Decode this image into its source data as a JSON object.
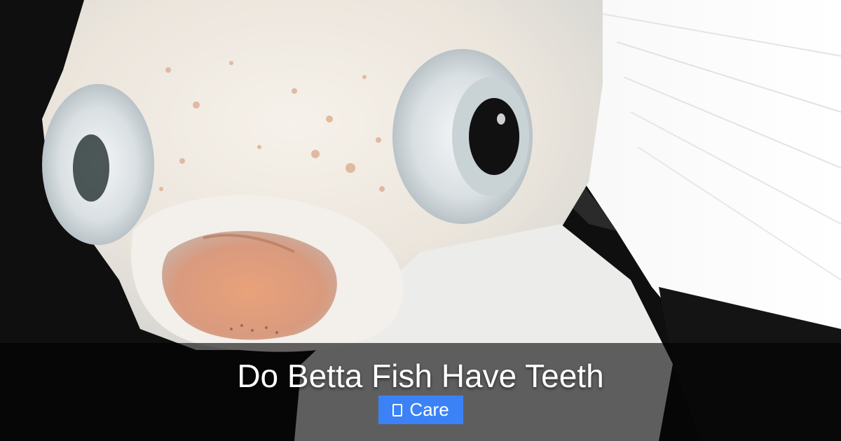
{
  "title": "Do Betta Fish Have Teeth",
  "category": {
    "label": "Care",
    "icon": "folder-icon",
    "color": "#3b82f6"
  }
}
